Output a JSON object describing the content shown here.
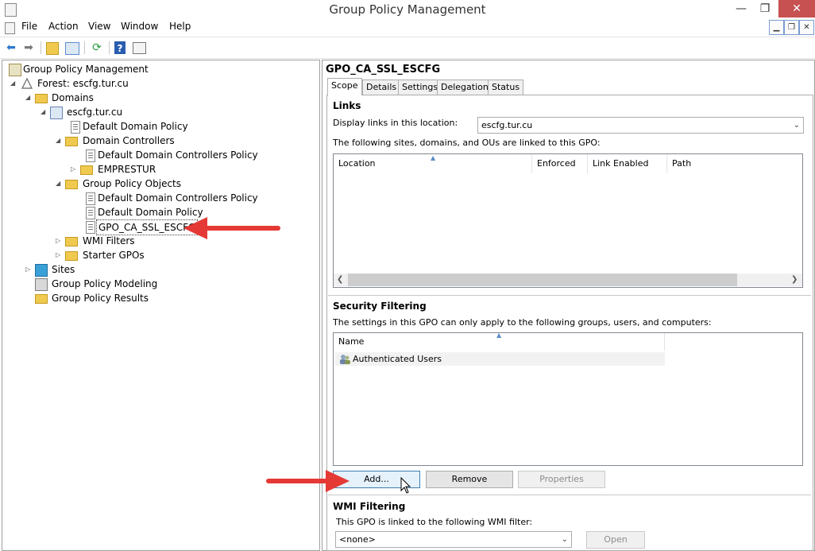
{
  "window": {
    "title": "Group Policy Management",
    "min": "—",
    "restore": "❐",
    "close": "✕"
  },
  "menu": [
    "File",
    "Action",
    "View",
    "Window",
    "Help"
  ],
  "tree": {
    "root": "Group Policy Management",
    "forest": "Forest: escfg.tur.cu",
    "domains": "Domains",
    "domain": "escfg.tur.cu",
    "default_domain_policy": "Default Domain Policy",
    "domain_controllers": "Domain Controllers",
    "dc_policy": "Default Domain Controllers Policy",
    "emprestur": "EMPRESTUR",
    "gpo_objects": "Group Policy Objects",
    "gpo_dc_policy": "Default Domain Controllers Policy",
    "gpo_domain_policy": "Default Domain Policy",
    "gpo_selected": "GPO_CA_SSL_ESCFG",
    "wmi_filters": "WMI Filters",
    "starter_gpos": "Starter GPOs",
    "sites": "Sites",
    "modeling": "Group Policy Modeling",
    "results": "Group Policy Results"
  },
  "details": {
    "header": "GPO_CA_SSL_ESCFG",
    "tabs": [
      "Scope",
      "Details",
      "Settings",
      "Delegation",
      "Status"
    ],
    "links": {
      "title": "Links",
      "display_label": "Display links in this location:",
      "location_value": "escfg.tur.cu",
      "description": "The following sites, domains, and OUs are linked to this GPO:",
      "columns": [
        "Location",
        "Enforced",
        "Link Enabled",
        "Path"
      ]
    },
    "security": {
      "title": "Security Filtering",
      "description": "The settings in this GPO can only apply to the following groups, users, and computers:",
      "column": "Name",
      "rows": [
        "Authenticated Users"
      ],
      "buttons": {
        "add": "Add...",
        "remove": "Remove",
        "properties": "Properties"
      }
    },
    "wmi": {
      "title": "WMI Filtering",
      "description": "This GPO is linked to the following WMI filter:",
      "value": "<none>",
      "open": "Open"
    }
  },
  "colors": {
    "annotation_arrow": "#e53935",
    "close_button": "#c75050"
  }
}
